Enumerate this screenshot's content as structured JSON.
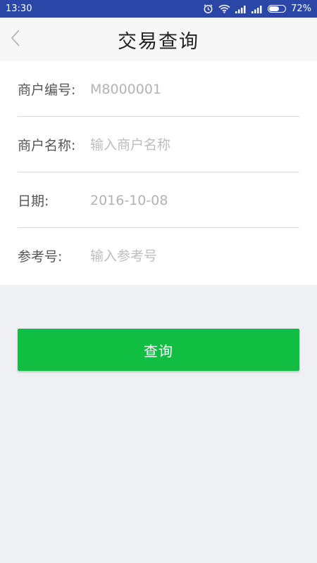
{
  "status_bar": {
    "time": "13:30",
    "battery": "72%",
    "battery_level": 0.72,
    "icons": [
      "alarm-icon",
      "wifi-icon",
      "signal-icon",
      "signal-icon",
      "battery-icon"
    ]
  },
  "nav": {
    "title": "交易查询",
    "back_icon": "chevron-left-icon"
  },
  "form": {
    "merchant_id": {
      "label": "商户编号:",
      "value": "M8000001"
    },
    "merchant_name": {
      "label": "商户名称:",
      "placeholder": "输入商户名称"
    },
    "date": {
      "label": "日期:",
      "value": "2016-10-08"
    },
    "reference": {
      "label": "参考号:",
      "placeholder": "输入参考号"
    }
  },
  "query_button": {
    "label": "查询"
  },
  "colors": {
    "status_bar": "#2a47a8",
    "accent_green": "#10be42",
    "background": "#eef0f4"
  }
}
